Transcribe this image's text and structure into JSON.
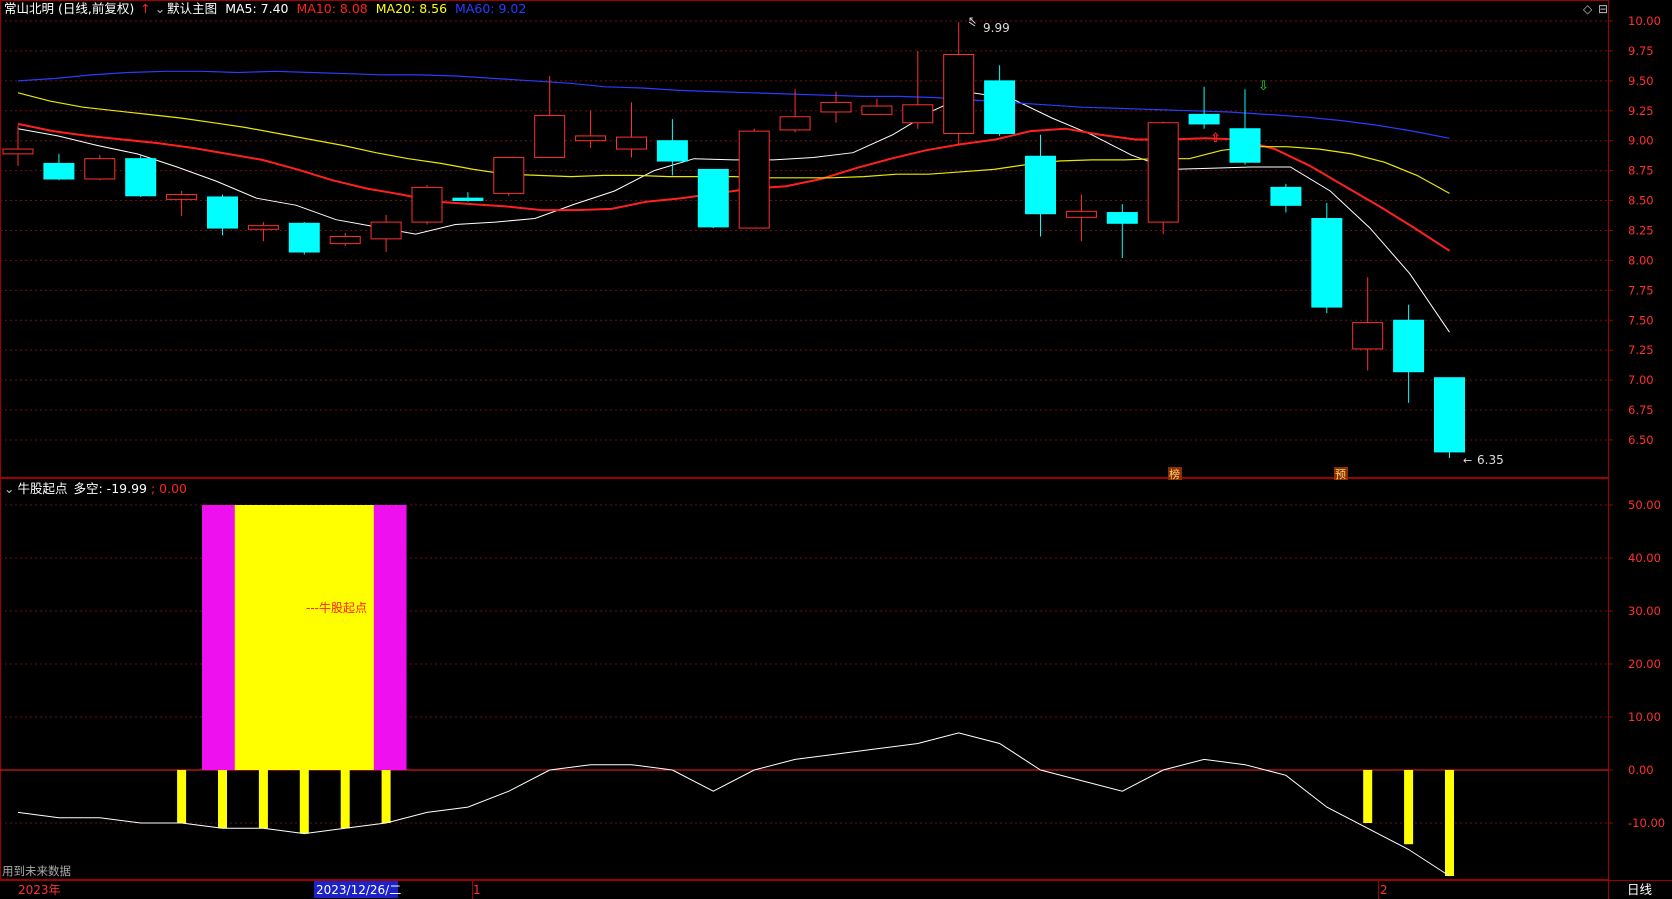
{
  "main_header": {
    "title": "常山北明 (日线,前复权)",
    "template": "默认主图",
    "ma5": "MA5: 7.40",
    "ma10": "MA10: 8.08",
    "ma20": "MA20: 8.56",
    "ma60": "MA60: 9.02",
    "colors": {
      "ma5": "#ffffff",
      "ma10": "#ff2020",
      "ma20": "#ffff00",
      "ma60": "#2a3cff"
    }
  },
  "sub_header": {
    "indicator": "牛股起点",
    "label": "多空: -19.99",
    "extra": "; 0.00"
  },
  "annotations": {
    "high": "9.99",
    "low": "6.35",
    "bang": "榜",
    "yu": "预",
    "bull_start": "---牛股起点",
    "future_data": "用到未来数据"
  },
  "bottom_bar": {
    "year": "2023年",
    "cursor_date": "2023/12/26/二",
    "month1": "1",
    "month2": "2",
    "period": "日线"
  },
  "price_axis": [
    "10.00",
    "9.75",
    "9.50",
    "9.25",
    "9.00",
    "8.75",
    "8.50",
    "8.25",
    "8.00",
    "7.75",
    "7.50",
    "7.25",
    "7.00",
    "6.75",
    "6.50"
  ],
  "osc_axis": [
    "50.00",
    "40.00",
    "30.00",
    "20.00",
    "10.00",
    "0.00",
    "-10.00"
  ],
  "chart_data": [
    {
      "type": "candlestick",
      "title": "常山北明 (日线,前复权)",
      "ylim": [
        6.3,
        10.05
      ],
      "candles": [
        {
          "o": 8.89,
          "h": 9.13,
          "l": 8.79,
          "c": 8.93
        },
        {
          "o": 8.81,
          "h": 8.89,
          "l": 8.67,
          "c": 8.68
        },
        {
          "o": 8.68,
          "h": 8.88,
          "l": 8.67,
          "c": 8.85
        },
        {
          "o": 8.85,
          "h": 8.88,
          "l": 8.53,
          "c": 8.54
        },
        {
          "o": 8.51,
          "h": 8.58,
          "l": 8.37,
          "c": 8.55
        },
        {
          "o": 8.53,
          "h": 8.55,
          "l": 8.21,
          "c": 8.27
        },
        {
          "o": 8.26,
          "h": 8.32,
          "l": 8.16,
          "c": 8.29
        },
        {
          "o": 8.31,
          "h": 8.32,
          "l": 8.05,
          "c": 8.07
        },
        {
          "o": 8.14,
          "h": 8.23,
          "l": 8.12,
          "c": 8.2
        },
        {
          "o": 8.18,
          "h": 8.38,
          "l": 8.07,
          "c": 8.32
        },
        {
          "o": 8.32,
          "h": 8.63,
          "l": 8.3,
          "c": 8.61
        },
        {
          "o": 8.52,
          "h": 8.57,
          "l": 8.49,
          "c": 8.5
        },
        {
          "o": 8.56,
          "h": 8.86,
          "l": 8.54,
          "c": 8.86
        },
        {
          "o": 8.86,
          "h": 9.54,
          "l": 8.86,
          "c": 9.21
        },
        {
          "o": 9.0,
          "h": 9.25,
          "l": 8.94,
          "c": 9.04
        },
        {
          "o": 8.93,
          "h": 9.32,
          "l": 8.86,
          "c": 9.03
        },
        {
          "o": 9.0,
          "h": 9.18,
          "l": 8.71,
          "c": 8.83
        },
        {
          "o": 8.76,
          "h": 8.76,
          "l": 8.27,
          "c": 8.28
        },
        {
          "o": 8.27,
          "h": 9.1,
          "l": 8.27,
          "c": 9.08
        },
        {
          "o": 9.09,
          "h": 9.43,
          "l": 9.07,
          "c": 9.2
        },
        {
          "o": 9.24,
          "h": 9.41,
          "l": 9.15,
          "c": 9.32
        },
        {
          "o": 9.22,
          "h": 9.35,
          "l": 9.22,
          "c": 9.29
        },
        {
          "o": 9.15,
          "h": 9.75,
          "l": 9.1,
          "c": 9.3
        },
        {
          "o": 9.06,
          "h": 9.99,
          "l": 8.97,
          "c": 9.72
        },
        {
          "o": 9.5,
          "h": 9.63,
          "l": 9.04,
          "c": 9.06
        },
        {
          "o": 8.87,
          "h": 9.05,
          "l": 8.2,
          "c": 8.39
        },
        {
          "o": 8.36,
          "h": 8.55,
          "l": 8.16,
          "c": 8.41
        },
        {
          "o": 8.4,
          "h": 8.47,
          "l": 8.02,
          "c": 8.31
        },
        {
          "o": 8.32,
          "h": 9.16,
          "l": 8.22,
          "c": 9.15
        },
        {
          "o": 9.22,
          "h": 9.45,
          "l": 9.1,
          "c": 9.14
        },
        {
          "o": 9.1,
          "h": 9.43,
          "l": 8.8,
          "c": 8.82
        },
        {
          "o": 8.61,
          "h": 8.64,
          "l": 8.4,
          "c": 8.46
        },
        {
          "o": 8.35,
          "h": 8.48,
          "l": 7.56,
          "c": 7.61
        },
        {
          "o": 7.26,
          "h": 7.86,
          "l": 7.08,
          "c": 7.48
        },
        {
          "o": 7.5,
          "h": 7.63,
          "l": 6.81,
          "c": 7.07
        },
        {
          "o": 7.02,
          "h": 7.02,
          "l": 6.35,
          "c": 6.4
        }
      ],
      "series": [
        {
          "name": "MA5",
          "values": [
            9.1,
            9.04,
            8.96,
            8.89,
            8.78,
            8.66,
            8.52,
            8.46,
            8.34,
            8.28,
            8.22,
            8.3,
            8.32,
            8.35,
            8.47,
            8.58,
            8.75,
            8.85,
            8.84,
            8.84,
            8.86,
            8.9,
            9.05,
            9.25,
            9.4,
            9.35,
            9.19,
            9.05,
            8.88,
            8.76,
            8.77,
            8.78,
            8.78,
            8.58,
            8.27,
            7.89,
            7.4
          ]
        },
        {
          "name": "MA10",
          "values": [
            9.14,
            9.08,
            9.04,
            9.01,
            8.98,
            8.94,
            8.89,
            8.84,
            8.76,
            8.67,
            8.6,
            8.55,
            8.49,
            8.47,
            8.45,
            8.42,
            8.42,
            8.43,
            8.49,
            8.52,
            8.56,
            8.6,
            8.62,
            8.68,
            8.77,
            8.85,
            8.92,
            8.97,
            9.01,
            9.08,
            9.1,
            9.05,
            9.01,
            9.01,
            9.02,
            9.01,
            8.93,
            8.79,
            8.62,
            8.45,
            8.27,
            8.08
          ]
        },
        {
          "name": "MA20",
          "values": [
            9.4,
            9.33,
            9.28,
            9.25,
            9.22,
            9.19,
            9.15,
            9.11,
            9.06,
            9.01,
            8.96,
            8.9,
            8.85,
            8.81,
            8.76,
            8.72,
            8.71,
            8.7,
            8.71,
            8.71,
            8.7,
            8.7,
            8.7,
            8.69,
            8.69,
            8.69,
            8.7,
            8.72,
            8.72,
            8.74,
            8.76,
            8.8,
            8.83,
            8.84,
            8.84,
            8.85,
            8.85,
            8.92,
            8.95,
            8.95,
            8.93,
            8.89,
            8.82,
            8.71,
            8.56
          ]
        },
        {
          "name": "MA60",
          "values": [
            9.5,
            9.52,
            9.55,
            9.57,
            9.58,
            9.58,
            9.57,
            9.58,
            9.57,
            9.56,
            9.55,
            9.55,
            9.54,
            9.52,
            9.5,
            9.48,
            9.45,
            9.44,
            9.42,
            9.41,
            9.4,
            9.39,
            9.38,
            9.37,
            9.37,
            9.36,
            9.34,
            9.32,
            9.3,
            9.28,
            9.27,
            9.26,
            9.25,
            9.24,
            9.22,
            9.2,
            9.17,
            9.13,
            9.08,
            9.02
          ]
        }
      ]
    },
    {
      "type": "bar",
      "title": "牛股起点",
      "ylim": [
        -20,
        55
      ],
      "line_name": "多空",
      "line_values": [
        -8,
        -9,
        -9,
        -10,
        -10,
        -11,
        -11,
        -12,
        -11,
        -10,
        -8,
        -7,
        -4,
        0,
        1,
        1,
        0,
        -4,
        0,
        2,
        3,
        4,
        5,
        7,
        5,
        0,
        -2,
        -4,
        0,
        2,
        1,
        -1,
        -7,
        -11,
        -15,
        -20
      ],
      "yellow_bars": [
        0,
        0,
        0,
        0,
        -10,
        -11,
        -11,
        -12,
        -11,
        -10,
        0,
        0,
        0,
        0,
        0,
        0,
        0,
        0,
        0,
        0,
        0,
        0,
        0,
        0,
        0,
        0,
        0,
        0,
        0,
        0,
        0,
        0,
        0,
        -10,
        -14,
        -20
      ],
      "signal_block": {
        "from_index": 5,
        "to_index": 9,
        "top": 50,
        "outer_color": "#ef10ef",
        "inner_color": "#ffff00"
      }
    }
  ]
}
